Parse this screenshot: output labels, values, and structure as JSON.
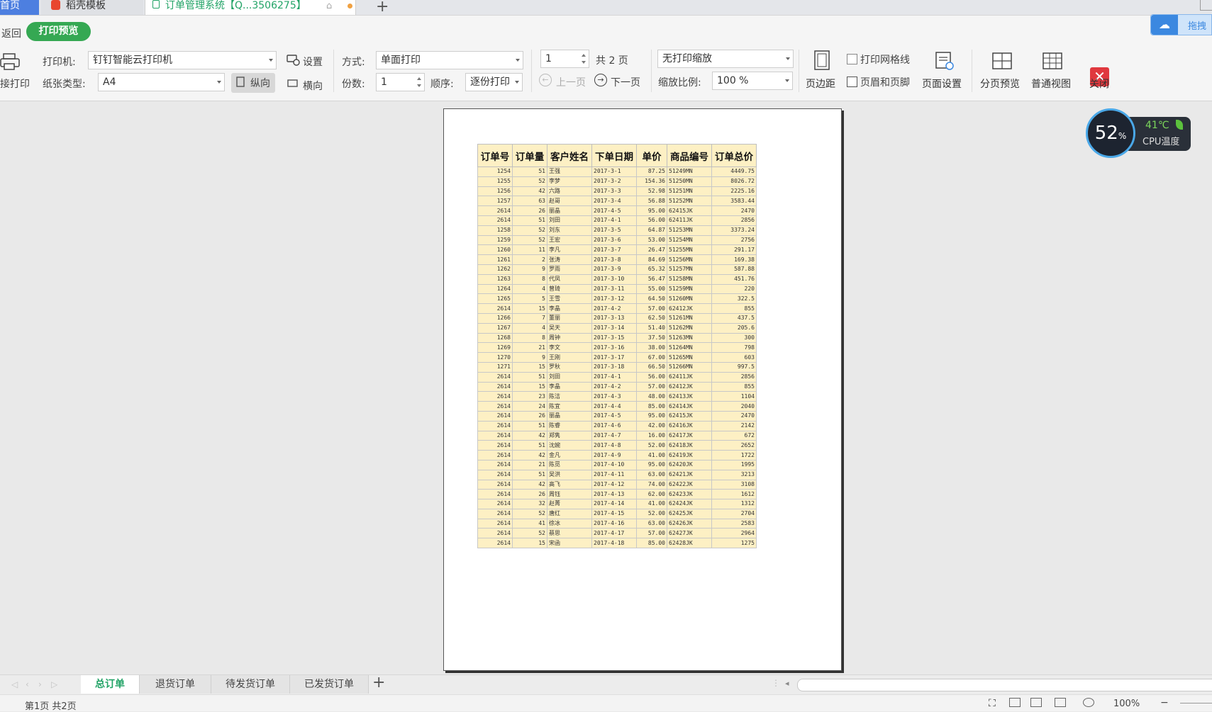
{
  "tabs": {
    "home": "首页",
    "template": "稻壳模板",
    "document": "订单管理系统【Q...3506275】",
    "new_tab": "+"
  },
  "toolbar": {
    "back": "返回",
    "print_preview": "打印预览",
    "direct_print": "直接打印",
    "printer_label": "打印机:",
    "printer_value": "钉钉智能云打印机",
    "settings": "设置",
    "paper_label": "纸张类型:",
    "paper_value": "A4",
    "portrait": "纵向",
    "landscape": "横向",
    "mode_label": "方式:",
    "mode_value": "单面打印",
    "copies_label": "份数:",
    "copies_value": "1",
    "order_label": "顺序:",
    "order_value": "逐份打印",
    "page_value": "1",
    "total_pages": "共 2 页",
    "prev_page": "上一页",
    "next_page": "下一页",
    "scale_value": "无打印缩放",
    "zoom_label": "缩放比例:",
    "zoom_value": "100 %",
    "margins": "页边距",
    "print_gridlines": "打印网格线",
    "header_footer": "页眉和页脚",
    "page_setup": "页面设置",
    "page_break_preview": "分页预览",
    "normal_view": "普通视图",
    "close": "关闭"
  },
  "cloud": {
    "label": "拖拽"
  },
  "cpu": {
    "percent": "52",
    "unit": "%",
    "temp": "41℃",
    "label": "CPU温度"
  },
  "table": {
    "headers": [
      "订单号",
      "订单量",
      "客户姓名",
      "下单日期",
      "单价",
      "商品编号",
      "订单总价"
    ],
    "rows": [
      [
        "1254",
        "51",
        "王强",
        "2017-3-1",
        "87.25",
        "51249MN",
        "4449.75"
      ],
      [
        "1255",
        "52",
        "李梦",
        "2017-3-2",
        "154.36",
        "51250MN",
        "8026.72"
      ],
      [
        "1256",
        "42",
        "六路",
        "2017-3-3",
        "52.98",
        "51251MN",
        "2225.16"
      ],
      [
        "1257",
        "63",
        "赵哥",
        "2017-3-4",
        "56.88",
        "51252MN",
        "3583.44"
      ],
      [
        "2614",
        "26",
        "丽晶",
        "2017-4-5",
        "95.00",
        "62415JK",
        "2470"
      ],
      [
        "2614",
        "51",
        "刘田",
        "2017-4-1",
        "56.00",
        "62411JK",
        "2856"
      ],
      [
        "1258",
        "52",
        "刘东",
        "2017-3-5",
        "64.87",
        "51253MN",
        "3373.24"
      ],
      [
        "1259",
        "52",
        "王宏",
        "2017-3-6",
        "53.00",
        "51254MN",
        "2756"
      ],
      [
        "1260",
        "11",
        "李凡",
        "2017-3-7",
        "26.47",
        "51255MN",
        "291.17"
      ],
      [
        "1261",
        "2",
        "张涛",
        "2017-3-8",
        "84.69",
        "51256MN",
        "169.38"
      ],
      [
        "1262",
        "9",
        "罗雨",
        "2017-3-9",
        "65.32",
        "51257MN",
        "587.88"
      ],
      [
        "1263",
        "8",
        "代凤",
        "2017-3-10",
        "56.47",
        "51258MN",
        "451.76"
      ],
      [
        "1264",
        "4",
        "曾琦",
        "2017-3-11",
        "55.00",
        "51259MN",
        "220"
      ],
      [
        "1265",
        "5",
        "王雪",
        "2017-3-12",
        "64.50",
        "51260MN",
        "322.5"
      ],
      [
        "2614",
        "15",
        "李晶",
        "2017-4-2",
        "57.00",
        "62412JK",
        "855"
      ],
      [
        "1266",
        "7",
        "董丽",
        "2017-3-13",
        "62.50",
        "51261MN",
        "437.5"
      ],
      [
        "1267",
        "4",
        "吴天",
        "2017-3-14",
        "51.40",
        "51262MN",
        "205.6"
      ],
      [
        "1268",
        "8",
        "周钟",
        "2017-3-15",
        "37.50",
        "51263MN",
        "300"
      ],
      [
        "1269",
        "21",
        "李文",
        "2017-3-16",
        "38.00",
        "51264MN",
        "798"
      ],
      [
        "1270",
        "9",
        "王刚",
        "2017-3-17",
        "67.00",
        "51265MN",
        "603"
      ],
      [
        "1271",
        "15",
        "罗秋",
        "2017-3-18",
        "66.50",
        "51266MN",
        "997.5"
      ],
      [
        "2614",
        "51",
        "刘田",
        "2017-4-1",
        "56.00",
        "62411JK",
        "2856"
      ],
      [
        "2614",
        "15",
        "李晶",
        "2017-4-2",
        "57.00",
        "62412JK",
        "855"
      ],
      [
        "2614",
        "23",
        "陈洁",
        "2017-4-3",
        "48.00",
        "62413JK",
        "1104"
      ],
      [
        "2614",
        "24",
        "陈宜",
        "2017-4-4",
        "85.00",
        "62414JK",
        "2040"
      ],
      [
        "2614",
        "26",
        "丽晶",
        "2017-4-5",
        "95.00",
        "62415JK",
        "2470"
      ],
      [
        "2614",
        "51",
        "陈睿",
        "2017-4-6",
        "42.00",
        "62416JK",
        "2142"
      ],
      [
        "2614",
        "42",
        "郑隽",
        "2017-4-7",
        "16.00",
        "62417JK",
        "672"
      ],
      [
        "2614",
        "51",
        "沈婉",
        "2017-4-8",
        "52.00",
        "62418JK",
        "2652"
      ],
      [
        "2614",
        "42",
        "金凡",
        "2017-4-9",
        "41.00",
        "62419JK",
        "1722"
      ],
      [
        "2614",
        "21",
        "陈觅",
        "2017-4-10",
        "95.00",
        "62420JK",
        "1995"
      ],
      [
        "2614",
        "51",
        "吴洪",
        "2017-4-11",
        "63.00",
        "62421JK",
        "3213"
      ],
      [
        "2614",
        "42",
        "高飞",
        "2017-4-12",
        "74.00",
        "62422JK",
        "3108"
      ],
      [
        "2614",
        "26",
        "周钰",
        "2017-4-13",
        "62.00",
        "62423JK",
        "1612"
      ],
      [
        "2614",
        "32",
        "赵菁",
        "2017-4-14",
        "41.00",
        "62424JK",
        "1312"
      ],
      [
        "2614",
        "52",
        "唐红",
        "2017-4-15",
        "52.00",
        "62425JK",
        "2704"
      ],
      [
        "2614",
        "41",
        "徐冰",
        "2017-4-16",
        "63.00",
        "62426JK",
        "2583"
      ],
      [
        "2614",
        "52",
        "蔡思",
        "2017-4-17",
        "57.00",
        "62427JK",
        "2964"
      ],
      [
        "2614",
        "15",
        "宋函",
        "2017-4-18",
        "85.00",
        "62428JK",
        "1275"
      ]
    ]
  },
  "sheets": [
    "总订单",
    "退货订单",
    "待发货订单",
    "已发货订单"
  ],
  "add_sheet": "+",
  "status": {
    "page_info": "第1页 共2页",
    "zoom": "100%"
  }
}
